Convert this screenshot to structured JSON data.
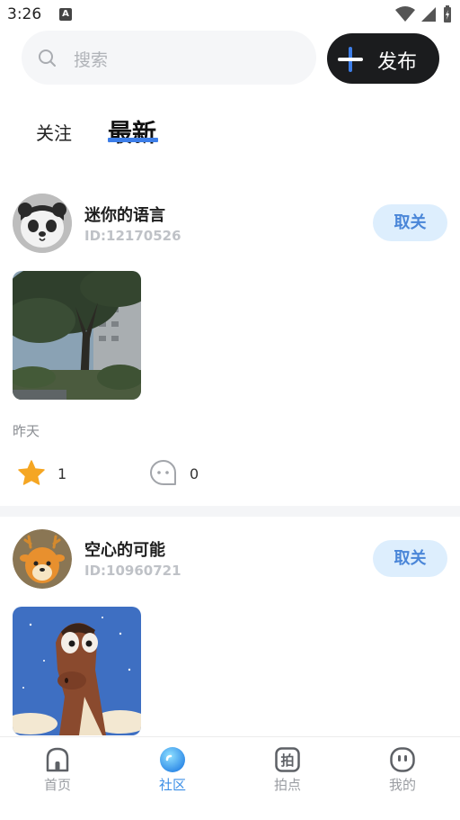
{
  "status_bar": {
    "time": "3:26",
    "notification_badge": "A"
  },
  "search": {
    "placeholder": "搜索"
  },
  "publish_button": {
    "label": "发布"
  },
  "tabs": [
    {
      "label": "关注",
      "active": false
    },
    {
      "label": "最新",
      "active": true
    }
  ],
  "posts": [
    {
      "username": "迷你的语言",
      "user_id": "ID:12170526",
      "follow_button": "取关",
      "time": "昨天",
      "stars": "1",
      "comments": "0",
      "avatar_icon": "panda-avatar-icon"
    },
    {
      "username": "空心的可能",
      "user_id": "ID:10960721",
      "follow_button": "取关",
      "avatar_icon": "deer-avatar-icon"
    }
  ],
  "bottom_nav": [
    {
      "label": "首页",
      "icon": "home-icon",
      "active": false
    },
    {
      "label": "社区",
      "icon": "community-icon",
      "active": true
    },
    {
      "label": "拍点",
      "icon": "camera-point-icon",
      "active": false
    },
    {
      "label": "我的",
      "icon": "profile-icon",
      "active": false
    }
  ],
  "colors": {
    "accent": "#3d7ee8",
    "publish_bg": "#1b1c1e",
    "unfollow_bg": "#ddeefd",
    "unfollow_text": "#4a86d8",
    "star": "#f5a623"
  }
}
